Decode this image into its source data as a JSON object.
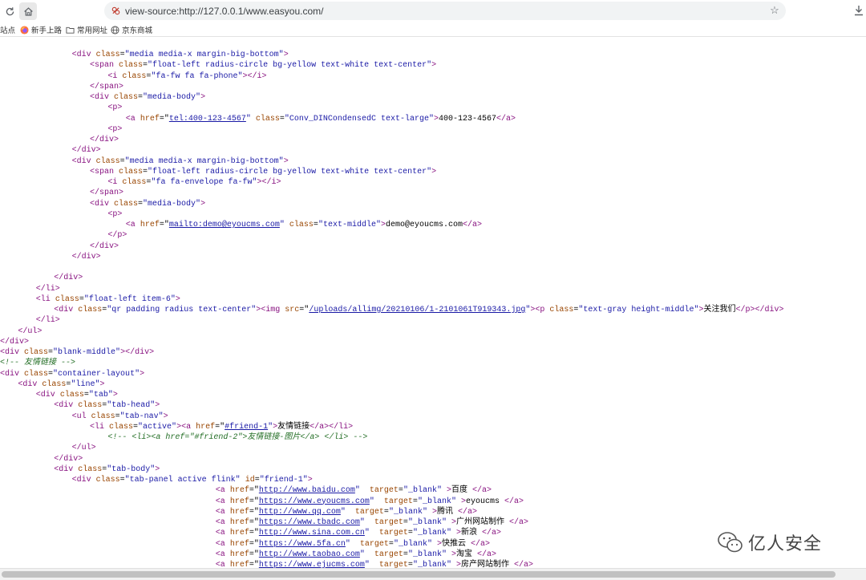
{
  "browser": {
    "url": "view-source:http://127.0.0.1/www.easyou.com/",
    "bookmarks": [
      "站点",
      "新手上路",
      "常用网址",
      "京东商城"
    ]
  },
  "source_lines": [
    [
      [
        "",
        "        "
      ],
      [
        "t",
        "<div "
      ],
      [
        "a",
        "class"
      ],
      [
        "",
        "="
      ],
      [
        "v",
        "\"media media-x margin-big-bottom\""
      ],
      [
        "t",
        ">"
      ]
    ],
    [
      [
        "",
        "          "
      ],
      [
        "t",
        "<span "
      ],
      [
        "a",
        "class"
      ],
      [
        "",
        "="
      ],
      [
        "v",
        "\"float-left radius-circle bg-yellow text-white text-center\""
      ],
      [
        "t",
        ">"
      ]
    ],
    [
      [
        "",
        "            "
      ],
      [
        "t",
        "<i "
      ],
      [
        "a",
        "class"
      ],
      [
        "",
        "="
      ],
      [
        "v",
        "\"fa-fw fa fa-phone\""
      ],
      [
        "t",
        "></i>"
      ]
    ],
    [
      [
        "",
        "          "
      ],
      [
        "t",
        "</span>"
      ]
    ],
    [
      [
        "",
        "          "
      ],
      [
        "t",
        "<div "
      ],
      [
        "a",
        "class"
      ],
      [
        "",
        "="
      ],
      [
        "v",
        "\"media-body\""
      ],
      [
        "t",
        ">"
      ]
    ],
    [
      [
        "",
        "            "
      ],
      [
        "t",
        "<p>"
      ]
    ],
    [
      [
        "",
        "              "
      ],
      [
        "t",
        "<a "
      ],
      [
        "a",
        "href"
      ],
      [
        "",
        "=\""
      ],
      [
        "lk",
        "tel:400-123-4567"
      ],
      [
        "v",
        "\""
      ],
      [
        "",
        " "
      ],
      [
        "a",
        "class"
      ],
      [
        "",
        "="
      ],
      [
        "v",
        "\"Conv_DINCondensedC text-large\""
      ],
      [
        "t",
        ">"
      ],
      [
        "",
        "400-123-4567"
      ],
      [
        "t",
        "</a>"
      ]
    ],
    [
      [
        "",
        "            "
      ],
      [
        "t",
        "<p>"
      ]
    ],
    [
      [
        "",
        "          "
      ],
      [
        "t",
        "</div>"
      ]
    ],
    [
      [
        "",
        "        "
      ],
      [
        "t",
        "</div>"
      ]
    ],
    [
      [
        "",
        "        "
      ],
      [
        "t",
        "<div "
      ],
      [
        "a",
        "class"
      ],
      [
        "",
        "="
      ],
      [
        "v",
        "\"media media-x margin-big-bottom\""
      ],
      [
        "t",
        ">"
      ]
    ],
    [
      [
        "",
        "          "
      ],
      [
        "t",
        "<span "
      ],
      [
        "a",
        "class"
      ],
      [
        "",
        "="
      ],
      [
        "v",
        "\"float-left radius-circle bg-yellow text-white text-center\""
      ],
      [
        "t",
        ">"
      ]
    ],
    [
      [
        "",
        "            "
      ],
      [
        "t",
        "<i "
      ],
      [
        "a",
        "class"
      ],
      [
        "",
        "="
      ],
      [
        "v",
        "\"fa fa-envelope fa-fw\""
      ],
      [
        "t",
        "></i>"
      ]
    ],
    [
      [
        "",
        "          "
      ],
      [
        "t",
        "</span>"
      ]
    ],
    [
      [
        "",
        "          "
      ],
      [
        "t",
        "<div "
      ],
      [
        "a",
        "class"
      ],
      [
        "",
        "="
      ],
      [
        "v",
        "\"media-body\""
      ],
      [
        "t",
        ">"
      ]
    ],
    [
      [
        "",
        "            "
      ],
      [
        "t",
        "<p>"
      ]
    ],
    [
      [
        "",
        "              "
      ],
      [
        "t",
        "<a "
      ],
      [
        "a",
        "href"
      ],
      [
        "",
        "=\""
      ],
      [
        "lk",
        "mailto:demo@eyoucms.com"
      ],
      [
        "v",
        "\""
      ],
      [
        "",
        " "
      ],
      [
        "a",
        "class"
      ],
      [
        "",
        "="
      ],
      [
        "v",
        "\"text-middle\""
      ],
      [
        "t",
        ">"
      ],
      [
        "",
        "demo@eyoucms.com"
      ],
      [
        "t",
        "</a>"
      ]
    ],
    [
      [
        "",
        "            "
      ],
      [
        "t",
        "</p>"
      ]
    ],
    [
      [
        "",
        "          "
      ],
      [
        "t",
        "</div>"
      ]
    ],
    [
      [
        "",
        "        "
      ],
      [
        "t",
        "</div>"
      ]
    ],
    [
      [
        "",
        ""
      ]
    ],
    [
      [
        "",
        "      "
      ],
      [
        "t",
        "</div>"
      ]
    ],
    [
      [
        "",
        "    "
      ],
      [
        "t",
        "</li>"
      ]
    ],
    [
      [
        "",
        "    "
      ],
      [
        "t",
        "<li "
      ],
      [
        "a",
        "class"
      ],
      [
        "",
        "="
      ],
      [
        "v",
        "\"float-left item-6\""
      ],
      [
        "t",
        ">"
      ]
    ],
    [
      [
        "",
        "      "
      ],
      [
        "t",
        "<div "
      ],
      [
        "a",
        "class"
      ],
      [
        "",
        "="
      ],
      [
        "v",
        "\"qr padding radius text-center\""
      ],
      [
        "t",
        "><img "
      ],
      [
        "a",
        "src"
      ],
      [
        "",
        "=\""
      ],
      [
        "lk",
        "/uploads/allimg/20210106/1-2101061T919343.jpg"
      ],
      [
        "v",
        "\""
      ],
      [
        "t",
        "><p "
      ],
      [
        "a",
        "class"
      ],
      [
        "",
        "="
      ],
      [
        "v",
        "\"text-gray height-middle\""
      ],
      [
        "t",
        ">"
      ],
      [
        "",
        "关注我们"
      ],
      [
        "t",
        "</p></div>"
      ]
    ],
    [
      [
        "",
        "    "
      ],
      [
        "t",
        "</li>"
      ]
    ],
    [
      [
        "",
        "  "
      ],
      [
        "t",
        "</ul>"
      ]
    ],
    [
      [
        "t",
        "</div>"
      ]
    ],
    [
      [
        "t",
        "<div "
      ],
      [
        "a",
        "class"
      ],
      [
        "",
        "="
      ],
      [
        "v",
        "\"blank-middle\""
      ],
      [
        "t",
        "></div>"
      ]
    ],
    [
      [
        "c",
        "<!-- 友情链接 -->"
      ]
    ],
    [
      [
        "t",
        "<div "
      ],
      [
        "a",
        "class"
      ],
      [
        "",
        "="
      ],
      [
        "v",
        "\"container-layout\""
      ],
      [
        "t",
        ">"
      ]
    ],
    [
      [
        "",
        "  "
      ],
      [
        "t",
        "<div "
      ],
      [
        "a",
        "class"
      ],
      [
        "",
        "="
      ],
      [
        "v",
        "\"line\""
      ],
      [
        "t",
        ">"
      ]
    ],
    [
      [
        "",
        "    "
      ],
      [
        "t",
        "<div "
      ],
      [
        "a",
        "class"
      ],
      [
        "",
        "="
      ],
      [
        "v",
        "\"tab\""
      ],
      [
        "t",
        ">"
      ]
    ],
    [
      [
        "",
        "      "
      ],
      [
        "t",
        "<div "
      ],
      [
        "a",
        "class"
      ],
      [
        "",
        "="
      ],
      [
        "v",
        "\"tab-head\""
      ],
      [
        "t",
        ">"
      ]
    ],
    [
      [
        "",
        "        "
      ],
      [
        "t",
        "<ul "
      ],
      [
        "a",
        "class"
      ],
      [
        "",
        "="
      ],
      [
        "v",
        "\"tab-nav\""
      ],
      [
        "t",
        ">"
      ]
    ],
    [
      [
        "",
        "          "
      ],
      [
        "t",
        "<li "
      ],
      [
        "a",
        "class"
      ],
      [
        "",
        "="
      ],
      [
        "v",
        "\"active\""
      ],
      [
        "t",
        "><a "
      ],
      [
        "a",
        "href"
      ],
      [
        "",
        "=\""
      ],
      [
        "lk",
        "#friend-1"
      ],
      [
        "v",
        "\""
      ],
      [
        "t",
        ">"
      ],
      [
        "",
        "友情链接"
      ],
      [
        "t",
        "</a></li>"
      ]
    ],
    [
      [
        "",
        "            "
      ],
      [
        "c",
        "<!-- <li><a href=\"#friend-2\">友情链接-图片</a> </li> -->"
      ]
    ],
    [
      [
        "",
        "        "
      ],
      [
        "t",
        "</ul>"
      ]
    ],
    [
      [
        "",
        "      "
      ],
      [
        "t",
        "</div>"
      ]
    ],
    [
      [
        "",
        "      "
      ],
      [
        "t",
        "<div "
      ],
      [
        "a",
        "class"
      ],
      [
        "",
        "="
      ],
      [
        "v",
        "\"tab-body\""
      ],
      [
        "t",
        ">"
      ]
    ],
    [
      [
        "",
        "        "
      ],
      [
        "t",
        "<div "
      ],
      [
        "a",
        "class"
      ],
      [
        "",
        "="
      ],
      [
        "v",
        "\"tab-panel active flink\""
      ],
      [
        "",
        " "
      ],
      [
        "a",
        "id"
      ],
      [
        "",
        "="
      ],
      [
        "v",
        "\"friend-1\""
      ],
      [
        "t",
        ">"
      ]
    ],
    [
      [
        "",
        "                        "
      ],
      [
        "t",
        "<a "
      ],
      [
        "a",
        "href"
      ],
      [
        "",
        "=\""
      ],
      [
        "lk",
        "http://www.baidu.com"
      ],
      [
        "v",
        "\""
      ],
      [
        "",
        "  "
      ],
      [
        "a",
        "target"
      ],
      [
        "",
        "="
      ],
      [
        "v",
        "\"_blank\""
      ],
      [
        "",
        " "
      ],
      [
        "t",
        ">"
      ],
      [
        "",
        "百度 "
      ],
      [
        "t",
        "</a>"
      ]
    ],
    [
      [
        "",
        "                        "
      ],
      [
        "t",
        "<a "
      ],
      [
        "a",
        "href"
      ],
      [
        "",
        "=\""
      ],
      [
        "lk",
        "https://www.eyoucms.com"
      ],
      [
        "v",
        "\""
      ],
      [
        "",
        "  "
      ],
      [
        "a",
        "target"
      ],
      [
        "",
        "="
      ],
      [
        "v",
        "\"_blank\""
      ],
      [
        "",
        " "
      ],
      [
        "t",
        ">"
      ],
      [
        "",
        "eyoucms "
      ],
      [
        "t",
        "</a>"
      ]
    ],
    [
      [
        "",
        "                        "
      ],
      [
        "t",
        "<a "
      ],
      [
        "a",
        "href"
      ],
      [
        "",
        "=\""
      ],
      [
        "lk",
        "http://www.qq.com"
      ],
      [
        "v",
        "\""
      ],
      [
        "",
        "  "
      ],
      [
        "a",
        "target"
      ],
      [
        "",
        "="
      ],
      [
        "v",
        "\"_blank\""
      ],
      [
        "",
        " "
      ],
      [
        "t",
        ">"
      ],
      [
        "",
        "腾讯 "
      ],
      [
        "t",
        "</a>"
      ]
    ],
    [
      [
        "",
        "                        "
      ],
      [
        "t",
        "<a "
      ],
      [
        "a",
        "href"
      ],
      [
        "",
        "=\""
      ],
      [
        "lk",
        "https://www.tbadc.com"
      ],
      [
        "v",
        "\""
      ],
      [
        "",
        "  "
      ],
      [
        "a",
        "target"
      ],
      [
        "",
        "="
      ],
      [
        "v",
        "\"_blank\""
      ],
      [
        "",
        " "
      ],
      [
        "t",
        ">"
      ],
      [
        "",
        "广州网站制作 "
      ],
      [
        "t",
        "</a>"
      ]
    ],
    [
      [
        "",
        "                        "
      ],
      [
        "t",
        "<a "
      ],
      [
        "a",
        "href"
      ],
      [
        "",
        "=\""
      ],
      [
        "lk",
        "http://www.sina.com.cn"
      ],
      [
        "v",
        "\""
      ],
      [
        "",
        "  "
      ],
      [
        "a",
        "target"
      ],
      [
        "",
        "="
      ],
      [
        "v",
        "\"_blank\""
      ],
      [
        "",
        " "
      ],
      [
        "t",
        ">"
      ],
      [
        "",
        "新浪 "
      ],
      [
        "t",
        "</a>"
      ]
    ],
    [
      [
        "",
        "                        "
      ],
      [
        "t",
        "<a "
      ],
      [
        "a",
        "href"
      ],
      [
        "",
        "=\""
      ],
      [
        "lk",
        "https://www.5fa.cn"
      ],
      [
        "v",
        "\""
      ],
      [
        "",
        "  "
      ],
      [
        "a",
        "target"
      ],
      [
        "",
        "="
      ],
      [
        "v",
        "\"_blank\""
      ],
      [
        "",
        " "
      ],
      [
        "t",
        ">"
      ],
      [
        "",
        "快推云 "
      ],
      [
        "t",
        "</a>"
      ]
    ],
    [
      [
        "",
        "                        "
      ],
      [
        "t",
        "<a "
      ],
      [
        "a",
        "href"
      ],
      [
        "",
        "=\""
      ],
      [
        "lk",
        "http://www.taobao.com"
      ],
      [
        "v",
        "\""
      ],
      [
        "",
        "  "
      ],
      [
        "a",
        "target"
      ],
      [
        "",
        "="
      ],
      [
        "v",
        "\"_blank\""
      ],
      [
        "",
        " "
      ],
      [
        "t",
        ">"
      ],
      [
        "",
        "淘宝 "
      ],
      [
        "t",
        "</a>"
      ]
    ],
    [
      [
        "",
        "                        "
      ],
      [
        "t",
        "<a "
      ],
      [
        "a",
        "href"
      ],
      [
        "",
        "=\""
      ],
      [
        "lk",
        "https://www.ejucms.com"
      ],
      [
        "v",
        "\""
      ],
      [
        "",
        "  "
      ],
      [
        "a",
        "target"
      ],
      [
        "",
        "="
      ],
      [
        "v",
        "\"_blank\""
      ],
      [
        "",
        " "
      ],
      [
        "t",
        ">"
      ],
      [
        "",
        "房产网站制作 "
      ],
      [
        "t",
        "</a>"
      ]
    ]
  ],
  "watermark": {
    "text": "亿人安全"
  },
  "colors": {
    "tag": "#881280",
    "attribute": "#994500",
    "value": "#1a1aa6",
    "comment": "#236e25"
  }
}
